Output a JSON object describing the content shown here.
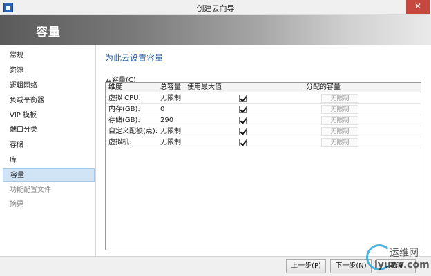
{
  "window": {
    "title": "创建云向导",
    "close_glyph": "✕"
  },
  "header": {
    "title": "容量"
  },
  "sidebar": {
    "items": [
      {
        "label": "常规",
        "state": "normal"
      },
      {
        "label": "资源",
        "state": "normal"
      },
      {
        "label": "逻辑网络",
        "state": "normal"
      },
      {
        "label": "负载平衡器",
        "state": "normal"
      },
      {
        "label": "VIP 模板",
        "state": "normal"
      },
      {
        "label": "端口分类",
        "state": "normal"
      },
      {
        "label": "存储",
        "state": "normal"
      },
      {
        "label": "库",
        "state": "normal"
      },
      {
        "label": "容量",
        "state": "active"
      },
      {
        "label": "功能配置文件",
        "state": "muted"
      },
      {
        "label": "摘要",
        "state": "muted"
      }
    ]
  },
  "main": {
    "section_title": "为此云设置容量",
    "group_label": "云容量(C):",
    "columns": [
      "维度",
      "总容量",
      "使用最大值",
      "分配的容量"
    ],
    "rows": [
      {
        "dimension": "虚拟 CPU:",
        "total": "无限制",
        "use_max": true,
        "allocated": "无限制"
      },
      {
        "dimension": "内存(GB):",
        "total": "0",
        "use_max": true,
        "allocated": "无限制"
      },
      {
        "dimension": "存储(GB):",
        "total": "290",
        "use_max": true,
        "allocated": "无限制"
      },
      {
        "dimension": "自定义配额(点):",
        "total": "无限制",
        "use_max": true,
        "allocated": "无限制"
      },
      {
        "dimension": "虚拟机:",
        "total": "无限制",
        "use_max": true,
        "allocated": "无限制"
      }
    ]
  },
  "footer": {
    "prev_label": "上一步(P)",
    "next_label": "下一步(N)",
    "cancel_label": "取消"
  },
  "watermark": {
    "line1": "运维网",
    "line2": "iyunv.com"
  }
}
